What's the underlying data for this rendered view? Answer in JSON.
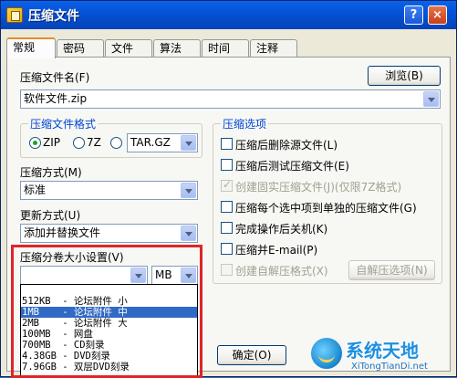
{
  "window": {
    "title": "压缩文件",
    "help": "?",
    "close": "×"
  },
  "tabs": [
    "常规",
    "密码",
    "文件",
    "算法",
    "时间",
    "注释"
  ],
  "general": {
    "archive_name_label": "压缩文件名(F)",
    "archive_name_value": "软件文件.zip",
    "browse_button": "浏览(B)",
    "format_group": "压缩文件格式",
    "format_zip": "ZIP",
    "format_7z": "7Z",
    "format_tar_value": "TAR.GZ",
    "method_label": "压缩方式(M)",
    "method_value": "标准",
    "update_label": "更新方式(U)",
    "update_value": "添加并替换文件",
    "volume_label": "压缩分卷大小设置(V)",
    "volume_value": "",
    "volume_unit": "MB",
    "volume_options": [
      "512KB  - 论坛附件 小",
      "1MB    - 论坛附件 中",
      "2MB    - 论坛附件 大",
      "100MB  - 网盘",
      "700MB  - CD刻录",
      "4.38GB - DVD刻录",
      "7.96GB - 双层DVD刻录"
    ],
    "volume_selected_index": 1
  },
  "options": {
    "group": "压缩选项",
    "items": [
      {
        "label": "压缩后删除源文件(L)",
        "checked": false,
        "disabled": false
      },
      {
        "label": "压缩后测试压缩文件(E)",
        "checked": false,
        "disabled": false
      },
      {
        "label": "创建固实压缩文件(J)(仅限7Z格式)",
        "checked": true,
        "disabled": true
      },
      {
        "label": "压缩每个选中项到单独的压缩文件(G)",
        "checked": false,
        "disabled": false
      },
      {
        "label": "完成操作后关机(K)",
        "checked": false,
        "disabled": false
      },
      {
        "label": "压缩并E-mail(P)",
        "checked": false,
        "disabled": false
      },
      {
        "label": "创建自解压格式(X)",
        "checked": false,
        "disabled": true
      }
    ],
    "sfx_options_button": "自解压选项(N)"
  },
  "buttons": {
    "ok": "确定(O)"
  },
  "watermark": {
    "name": "系统天地",
    "url": "XiTongTianDi.net"
  }
}
